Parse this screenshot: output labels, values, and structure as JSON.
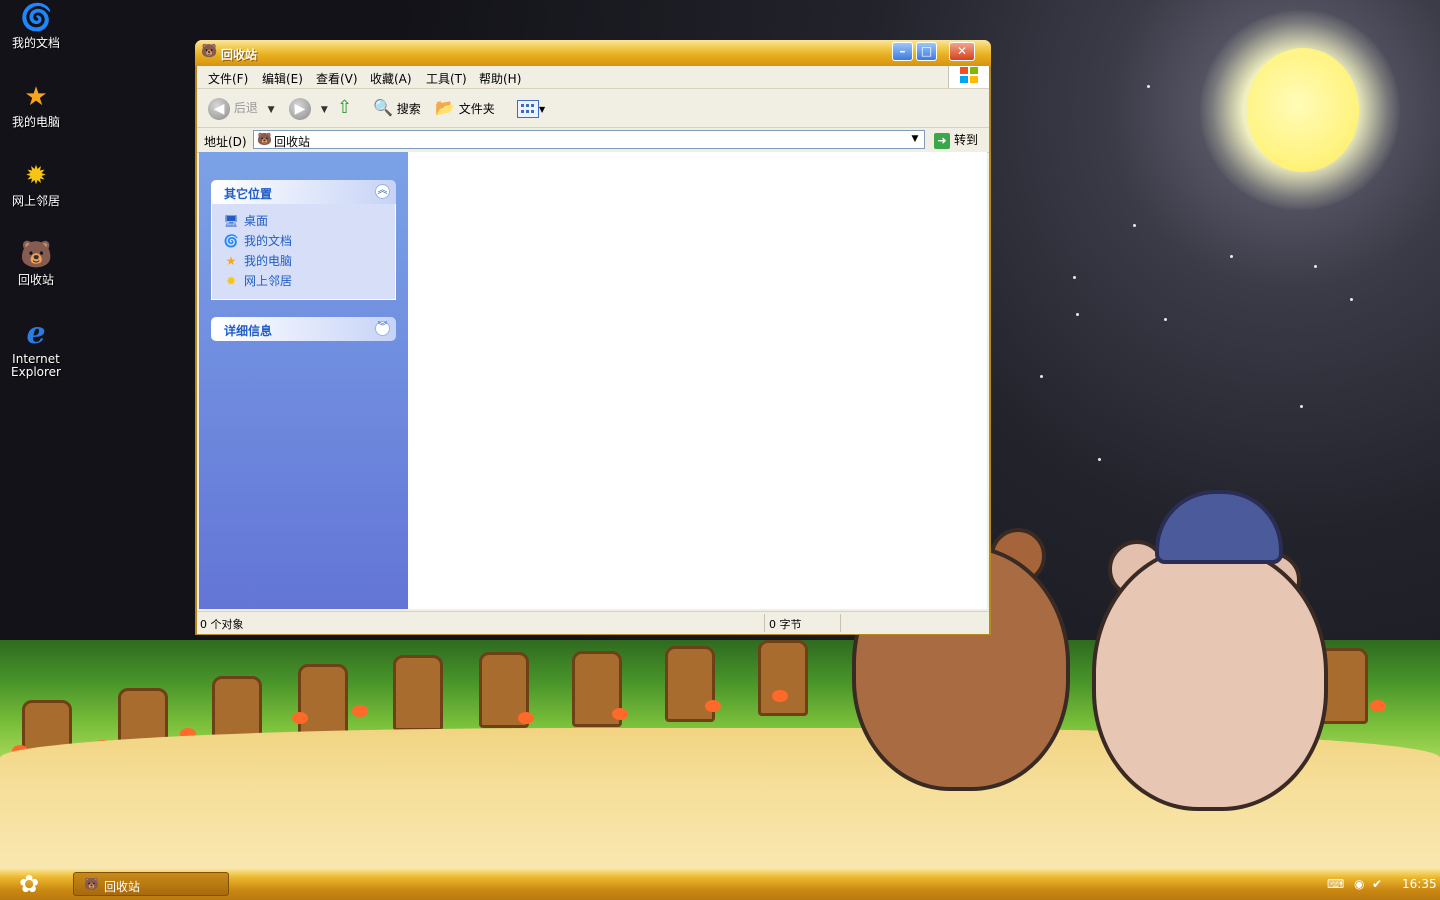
{
  "desktop": {
    "icons": [
      {
        "label": "我的文档",
        "icon": "my-documents-icon",
        "glyph": "🌀"
      },
      {
        "label": "我的电脑",
        "icon": "my-computer-icon",
        "glyph": "★"
      },
      {
        "label": "网上邻居",
        "icon": "network-places-icon",
        "glyph": "✹"
      },
      {
        "label": "回收站",
        "icon": "recycle-bin-icon",
        "glyph": "🐻"
      },
      {
        "label": "Internet Explorer",
        "icon": "internet-explorer-icon",
        "glyph": "e"
      }
    ]
  },
  "window": {
    "title": "回收站",
    "menus": [
      "文件(F)",
      "编辑(E)",
      "查看(V)",
      "收藏(A)",
      "工具(T)",
      "帮助(H)"
    ],
    "toolbar": {
      "back": "后退",
      "search": "搜索",
      "folders": "文件夹"
    },
    "address": {
      "label": "地址(D)",
      "value": "回收站",
      "go": "转到"
    },
    "taskpane": {
      "other_places": {
        "title": "其它位置",
        "links": [
          "桌面",
          "我的文档",
          "我的电脑",
          "网上邻居"
        ]
      },
      "details": {
        "title": "详细信息"
      }
    },
    "status": {
      "objects": "0 个对象",
      "size": "0 字节"
    }
  },
  "taskbar": {
    "item": "回收站",
    "clock": "16:35"
  },
  "colors": {
    "title_gold": "#e7ad1f",
    "taskpane_blue": "#6375d6",
    "link_blue": "#215dc6"
  }
}
